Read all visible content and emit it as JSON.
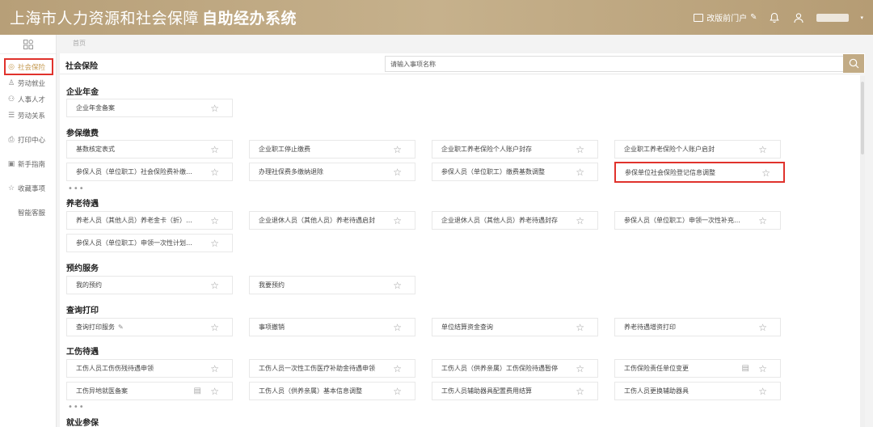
{
  "header": {
    "title_regular": "上海市人力资源和社会保障",
    "title_bold": "自助经办系统",
    "portal_label": "改版前门户"
  },
  "sidebar": {
    "items": [
      {
        "label": "社会保险",
        "icon": "coins-icon"
      },
      {
        "label": "劳动就业",
        "icon": "person-icon"
      },
      {
        "label": "人事人才",
        "icon": "people-icon"
      },
      {
        "label": "劳动关系",
        "icon": "form-icon"
      },
      {
        "label": "打印中心",
        "icon": "printer-icon"
      },
      {
        "label": "新手指南",
        "icon": "guide-icon"
      },
      {
        "label": "收藏事项",
        "icon": "star-icon"
      },
      {
        "label": "智能客服",
        "icon": ""
      }
    ]
  },
  "breadcrumb": "首页",
  "main": {
    "title": "社会保险",
    "search_placeholder": "请输入事项名称",
    "sections": {
      "s1": {
        "title": "企业年金",
        "items": [
          "企业年金备案"
        ]
      },
      "s2": {
        "title": "参保缴费",
        "items": [
          "基数核定表式",
          "企业职工停止缴费",
          "企业职工养老保险个人账户封存",
          "企业职工养老保险个人账户启封",
          "参保人员（单位职工）社会保险费补缴申报",
          "办理社保费多缴纳退除",
          "参保人员（单位职工）缴费基数调整",
          "参保单位社会保险登记信息调整"
        ],
        "more": "•••"
      },
      "s3": {
        "title": "养老待遇",
        "items": [
          "养老人员（其他人员）养老金卡（折）变更",
          "企业退休人员（其他人员）养老待遇启封",
          "企业退休人员（其他人员）养老待遇封存",
          "参保人员（单位职工）申领一次性补充养老金",
          "参保人员（单位职工）申领一次性计划生育奖励"
        ]
      },
      "s4": {
        "title": "预约服务",
        "items": [
          "我的预约",
          "我要预约"
        ]
      },
      "s5": {
        "title": "查询打印",
        "items": [
          "查询打印服务",
          "事项撤销",
          "单位结算资金查询",
          "养老待遇增资打印"
        ]
      },
      "s6": {
        "title": "工伤待遇",
        "items": [
          "工伤人员工伤伤残待遇申领",
          "工伤人员一次性工伤医疗补助金待遇申领",
          "工伤人员（供养亲属）工伤保险待遇暂停",
          "工伤保险责任单位变更",
          "工伤异地就医备案",
          "工伤人员（供养亲属）基本信息调整",
          "工伤人员辅助器具配置费用结算",
          "工伤人员更换辅助器具"
        ],
        "more": "•••"
      },
      "s7": {
        "title": "就业参保"
      }
    }
  }
}
